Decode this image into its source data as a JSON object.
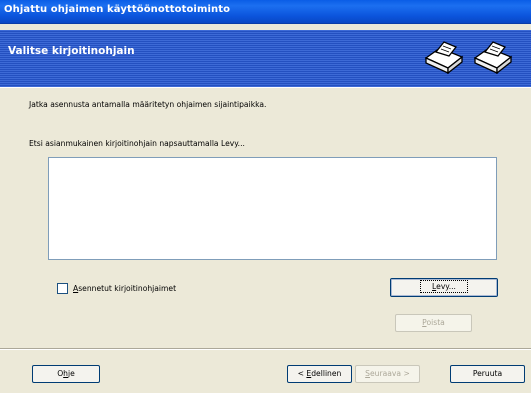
{
  "window": {
    "title": "Ohjattu ohjaimen käyttöönottotoiminto"
  },
  "header": {
    "title": "Valitse kirjoitinohjain",
    "icons": [
      "printer-icon",
      "printer-icon"
    ]
  },
  "content": {
    "intro": "Jatka asennusta antamalla määritetyn ohjaimen sijaintipaikka.",
    "instruction": "Etsi asianmukainen kirjoitinohjain napsauttamalla Levy...",
    "driver_list": [],
    "installed_checkbox": {
      "label_accel": "A",
      "label_rest": "sennetut kirjoitinohjaimet",
      "checked": false
    },
    "levy_button": {
      "accel": "L",
      "rest": "evy..."
    },
    "poista_button": {
      "accel": "P",
      "rest": "oista",
      "disabled": true
    }
  },
  "footer": {
    "ohje": {
      "pre": "O",
      "accel": "h",
      "rest": "je"
    },
    "edellinen": {
      "pre": "< ",
      "accel": "E",
      "rest": "dellinen"
    },
    "seuraava": {
      "accel": "S",
      "rest": "euraava >",
      "disabled": true
    },
    "peruuta": "Peruuta"
  },
  "colors": {
    "titlebar": "#0a5de6",
    "header": "#2a56c8",
    "dialog_bg": "#ece9d8",
    "disabled_text": "#aca899"
  }
}
